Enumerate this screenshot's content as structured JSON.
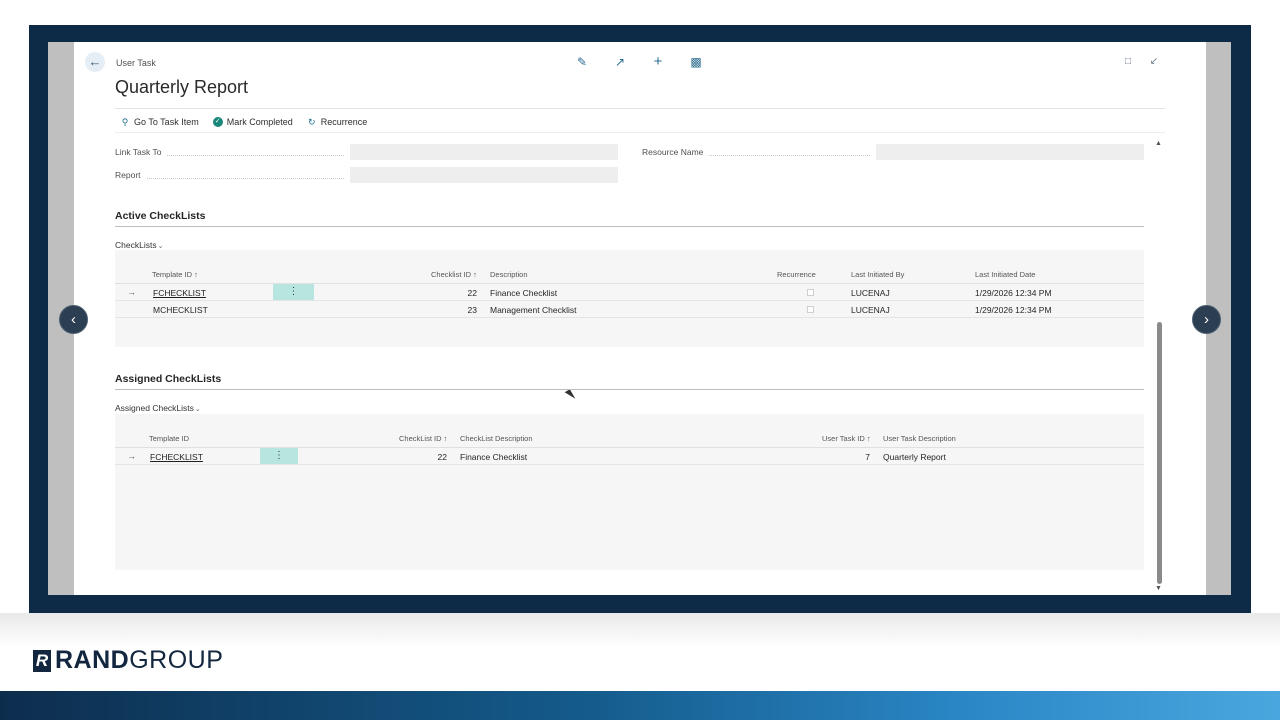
{
  "header": {
    "caption": "User Task",
    "title": "Quarterly Report"
  },
  "actions": {
    "go_to_task_item": "Go To Task Item",
    "mark_completed": "Mark Completed",
    "recurrence": "Recurrence"
  },
  "fields": {
    "link_task_to": {
      "label": "Link Task To",
      "value": ""
    },
    "report": {
      "label": "Report",
      "value": ""
    },
    "resource_name": {
      "label": "Resource Name",
      "value": ""
    }
  },
  "active_checklists": {
    "title": "Active CheckLists",
    "tab_label": "CheckLists",
    "columns": {
      "template_id": "Template ID ↑",
      "checklist_id": "Checklist ID ↑",
      "description": "Description",
      "recurrence": "Recurrence",
      "last_initiated_by": "Last Initiated By",
      "last_initiated_date": "Last Initiated Date"
    },
    "rows": [
      {
        "template_id": "FCHECKLIST",
        "checklist_id": "22",
        "description": "Finance Checklist",
        "recurrence": false,
        "last_initiated_by": "LUCENAJ",
        "last_initiated_date": "1/29/2026 12:34 PM"
      },
      {
        "template_id": "MCHECKLIST",
        "checklist_id": "23",
        "description": "Management Checklist",
        "recurrence": false,
        "last_initiated_by": "LUCENAJ",
        "last_initiated_date": "1/29/2026 12:34 PM"
      }
    ]
  },
  "assigned_checklists": {
    "title": "Assigned CheckLists",
    "tab_label": "Assigned CheckLists",
    "columns": {
      "template_id": "Template ID",
      "checklist_id": "CheckList ID ↑",
      "checklist_description": "CheckList Description",
      "user_task_id": "User Task ID ↑",
      "user_task_description": "User Task Description"
    },
    "rows": [
      {
        "template_id": "FCHECKLIST",
        "checklist_id": "22",
        "checklist_description": "Finance Checklist",
        "user_task_id": "7",
        "user_task_description": "Quarterly Report"
      }
    ]
  },
  "branding": {
    "logo_bold": "RAND",
    "logo_light": "GROUP",
    "brand_color": "#12263f",
    "accent_color": "#19877a"
  },
  "icons": {
    "back": "back-arrow-icon",
    "edit": "pencil-icon",
    "share": "share-icon",
    "new": "plus-icon",
    "delete": "trash-icon",
    "open_new_window": "open-new-window-icon",
    "collapse": "collapse-icon"
  }
}
